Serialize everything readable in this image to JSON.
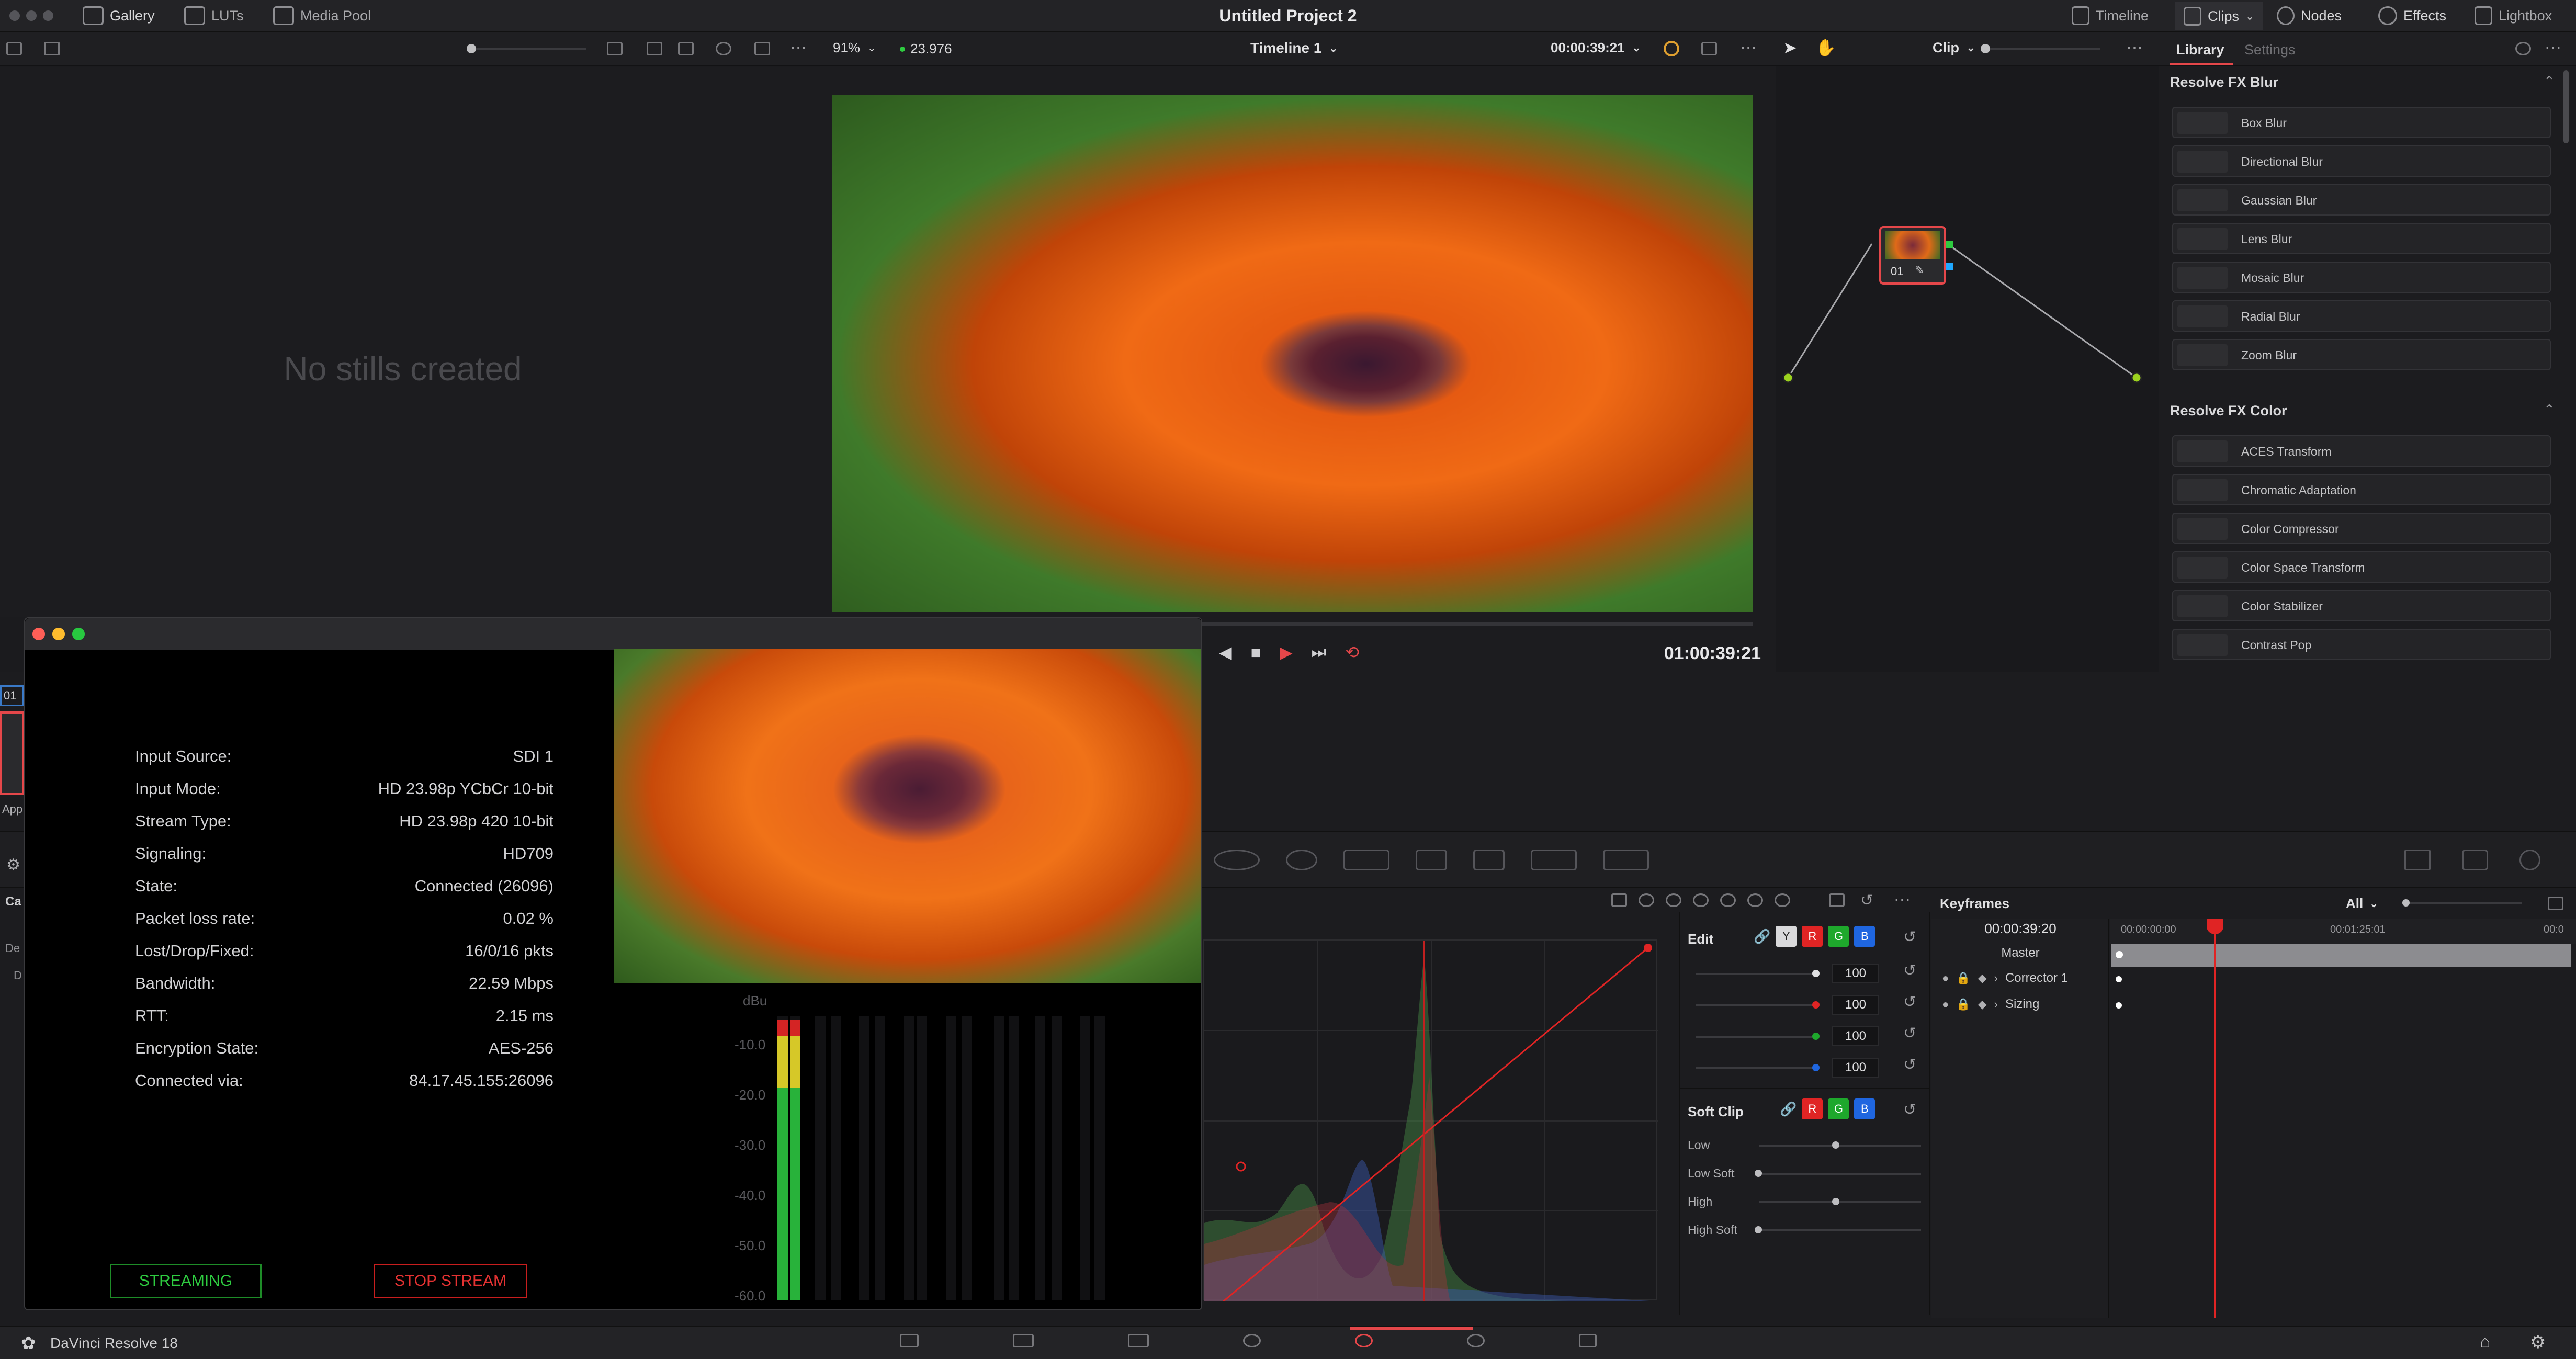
{
  "topbar": {
    "gallery": "Gallery",
    "luts": "LUTs",
    "media_pool": "Media Pool",
    "project_title": "Untitled Project 2",
    "timeline": "Timeline",
    "clips": "Clips",
    "nodes": "Nodes",
    "effects": "Effects",
    "lightbox": "Lightbox"
  },
  "viewer": {
    "zoom": "91%",
    "fps": "23.976",
    "timeline_name": "Timeline 1",
    "timecode": "00:00:39:21",
    "playback_timecode": "01:00:39:21",
    "node_mode": "Clip"
  },
  "gallery": {
    "empty_message": "No stills created"
  },
  "library": {
    "tab_library": "Library",
    "tab_settings": "Settings",
    "section_blur": "Resolve FX Blur",
    "blur_items": [
      "Box Blur",
      "Directional Blur",
      "Gaussian Blur",
      "Lens Blur",
      "Mosaic Blur",
      "Radial Blur",
      "Zoom Blur"
    ],
    "section_color": "Resolve FX Color",
    "color_items": [
      "ACES Transform",
      "Chromatic Adaptation",
      "Color Compressor",
      "Color Space Transform",
      "Color Stabilizer",
      "Contrast Pop"
    ]
  },
  "node": {
    "label": "01"
  },
  "stream": {
    "rows": [
      {
        "k": "Input Source:",
        "v": "SDI 1"
      },
      {
        "k": "Input Mode:",
        "v": "HD 23.98p YCbCr 10-bit"
      },
      {
        "k": "Stream Type:",
        "v": "HD 23.98p 420 10-bit"
      },
      {
        "k": "Signaling:",
        "v": "HD709"
      },
      {
        "k": "State:",
        "v": "Connected (26096)"
      },
      {
        "k": "Packet loss rate:",
        "v": "0.02 %"
      },
      {
        "k": "Lost/Drop/Fixed:",
        "v": "16/0/16 pkts"
      },
      {
        "k": "Bandwidth:",
        "v": "22.59 Mbps"
      },
      {
        "k": "RTT:",
        "v": "2.15 ms"
      },
      {
        "k": "Encryption State:",
        "v": "AES-256"
      },
      {
        "k": "Connected via:",
        "v": "84.17.45.155:26096"
      }
    ],
    "streaming_btn": "STREAMING",
    "stop_btn": "STOP STREAM",
    "meter_unit": "dBu",
    "meter_ticks": [
      "-10.0",
      "-20.0",
      "-30.0",
      "-40.0",
      "-50.0",
      "-60.0"
    ]
  },
  "curves": {
    "edit": "Edit",
    "y": "Y",
    "r": "R",
    "g": "G",
    "b": "B",
    "val_y": "100",
    "val_r": "100",
    "val_g": "100",
    "val_b": "100",
    "soft_clip": "Soft Clip",
    "low": "Low",
    "low_soft": "Low Soft",
    "high": "High",
    "high_soft": "High Soft"
  },
  "keyframes": {
    "title": "Keyframes",
    "filter": "All",
    "current_tc": "00:00:39:20",
    "tc_start": "00:00:00:00",
    "tc_mid": "00:01:25:01",
    "tc_end": "00:0",
    "master": "Master",
    "tracks": [
      "Corrector 1",
      "Sizing"
    ]
  },
  "footer": {
    "app_name": "DaVinci Resolve 18"
  },
  "left_stub": {
    "badge": "01",
    "label_app": "App",
    "label_ca": "Ca",
    "label_de": "De",
    "label_d": "D"
  },
  "colors": {
    "accent": "#e5474a",
    "bg": "#1b1b1e",
    "green": "#2ecc40",
    "red": "#e02424"
  }
}
